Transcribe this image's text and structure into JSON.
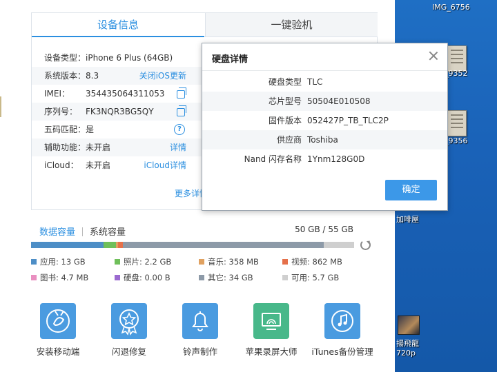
{
  "desktop": {
    "labels": [
      "IMG_6756",
      "_9352",
      "_9356",
      "加啡屋",
      "揚飛龍",
      "720p"
    ]
  },
  "tabs": {
    "device_info": "设备信息",
    "one_click_check": "一键验机"
  },
  "device_rows": [
    {
      "label": "设备类型：",
      "value": "iPhone 6 Plus   (64GB)",
      "action": ""
    },
    {
      "label": "系统版本：",
      "value": "8.3",
      "action": "关闭iOS更新"
    },
    {
      "label": "IMEI：",
      "value": "354435064311053",
      "action": ""
    },
    {
      "label": "序列号：",
      "value": "FK3NQR3BG5QY",
      "action": ""
    },
    {
      "label": "五码匹配：",
      "value": "是",
      "action": ""
    },
    {
      "label": "辅助功能：",
      "value": "未开启",
      "action": "详情"
    },
    {
      "label": "iCloud：",
      "value": "未开启",
      "action": "iCloud详情"
    }
  ],
  "more_link": "更多详情",
  "storage": {
    "tab_data": "数据容量",
    "tab_system": "系统容量",
    "total": "50 GB / 55 GB",
    "segments": [
      {
        "name": "应用",
        "fraction": 0.225,
        "color": "#4d8ec6"
      },
      {
        "name": "照片",
        "fraction": 0.038,
        "color": "#6fbf5a"
      },
      {
        "name": "音乐",
        "fraction": 0.007,
        "color": "#e0a160"
      },
      {
        "name": "视频",
        "fraction": 0.015,
        "color": "#e5704a"
      },
      {
        "name": "其它",
        "fraction": 0.62,
        "color": "#8d9aa8"
      },
      {
        "name": "可用",
        "fraction": 0.095,
        "color": "#cfcfcf"
      }
    ],
    "legend": [
      {
        "text": "应用: 13 GB",
        "color": "#4d8ec6"
      },
      {
        "text": "照片: 2.2 GB",
        "color": "#6fbf5a"
      },
      {
        "text": "音乐: 358 MB",
        "color": "#e0a160"
      },
      {
        "text": "视频: 862 MB",
        "color": "#e5704a"
      },
      {
        "text": "图书: 4.7 MB",
        "color": "#e98fc0"
      },
      {
        "text": "硬盘: 0.00 B",
        "color": "#9b6ad0"
      },
      {
        "text": "其它: 34 GB",
        "color": "#8d9aa8"
      },
      {
        "text": "可用: 5.7 GB",
        "color": "#cfcfcf"
      }
    ]
  },
  "tools": [
    {
      "label": "安装移动端",
      "color": "#4a9be0",
      "icon": "rabbit-icon"
    },
    {
      "label": "闪退修复",
      "color": "#4a9be0",
      "icon": "star-badge-icon"
    },
    {
      "label": "铃声制作",
      "color": "#4a9be0",
      "icon": "bell-icon"
    },
    {
      "label": "苹果录屏大师",
      "color": "#48b88a",
      "icon": "screen-cast-icon"
    },
    {
      "label": "iTunes备份管理",
      "color": "#4a9be0",
      "icon": "music-note-icon"
    }
  ],
  "dialog": {
    "title": "硬盘详情",
    "rows": [
      {
        "key": "硬盘类型",
        "value": "TLC"
      },
      {
        "key": "芯片型号",
        "value": "50504E010508"
      },
      {
        "key": "固件版本",
        "value": "052427P_TB_TLC2P"
      },
      {
        "key": "供应商",
        "value": "Toshiba"
      },
      {
        "key": "Nand 闪存名称",
        "value": "1Ynm128G0D"
      }
    ],
    "ok_label": "确定"
  }
}
